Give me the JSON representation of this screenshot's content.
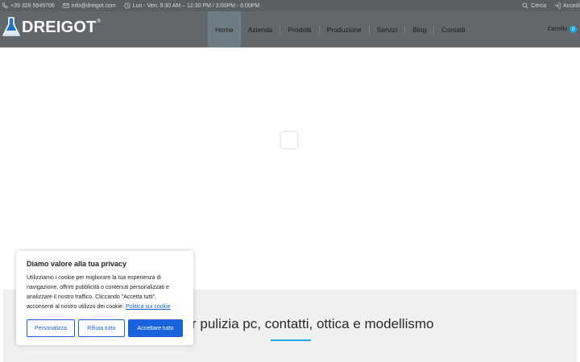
{
  "topbar": {
    "phone": "+39 328 5949706",
    "email": "info@dreigot.com",
    "hours": "Lun - Ven: 9:30 AM – 12:30 PM / 3:00PM - 6:00PM",
    "search_label": "Cerca",
    "login_label": "Accedi"
  },
  "header": {
    "logo_text": "DREIGOT",
    "logo_reg": "®",
    "nav": [
      {
        "label": "Home",
        "active": true
      },
      {
        "label": "Azienda"
      },
      {
        "label": "Prodotti"
      },
      {
        "label": "Produzione"
      },
      {
        "label": "Servizi"
      },
      {
        "label": "Blog"
      },
      {
        "label": "Contatti"
      }
    ],
    "cart_label": "Carrello",
    "cart_count": "0"
  },
  "section": {
    "heading": "r pulizia pc, contatti, ottica e modellismo"
  },
  "cookie": {
    "title": "Diamo valore alla tua privacy",
    "text": "Utilizziamo i cookie per migliorare la tua esperienza di navigazione, offrirti pubblicità o contenuti personalizzati e analizzare il nostro traffico. Cliccando \"Accetta tutti\", acconsenti al nostro utilizzo dei cookie.",
    "link": "Politica sui cookie",
    "buttons": {
      "customize": "Personalizza",
      "reject": "Rifiuta tutto",
      "accept": "Accettare tutto"
    }
  },
  "colors": {
    "accent": "#1ea7e8",
    "cookie_blue": "#1863dc",
    "header_bg": "#63666b",
    "topbar_bg": "#5b5e63"
  }
}
